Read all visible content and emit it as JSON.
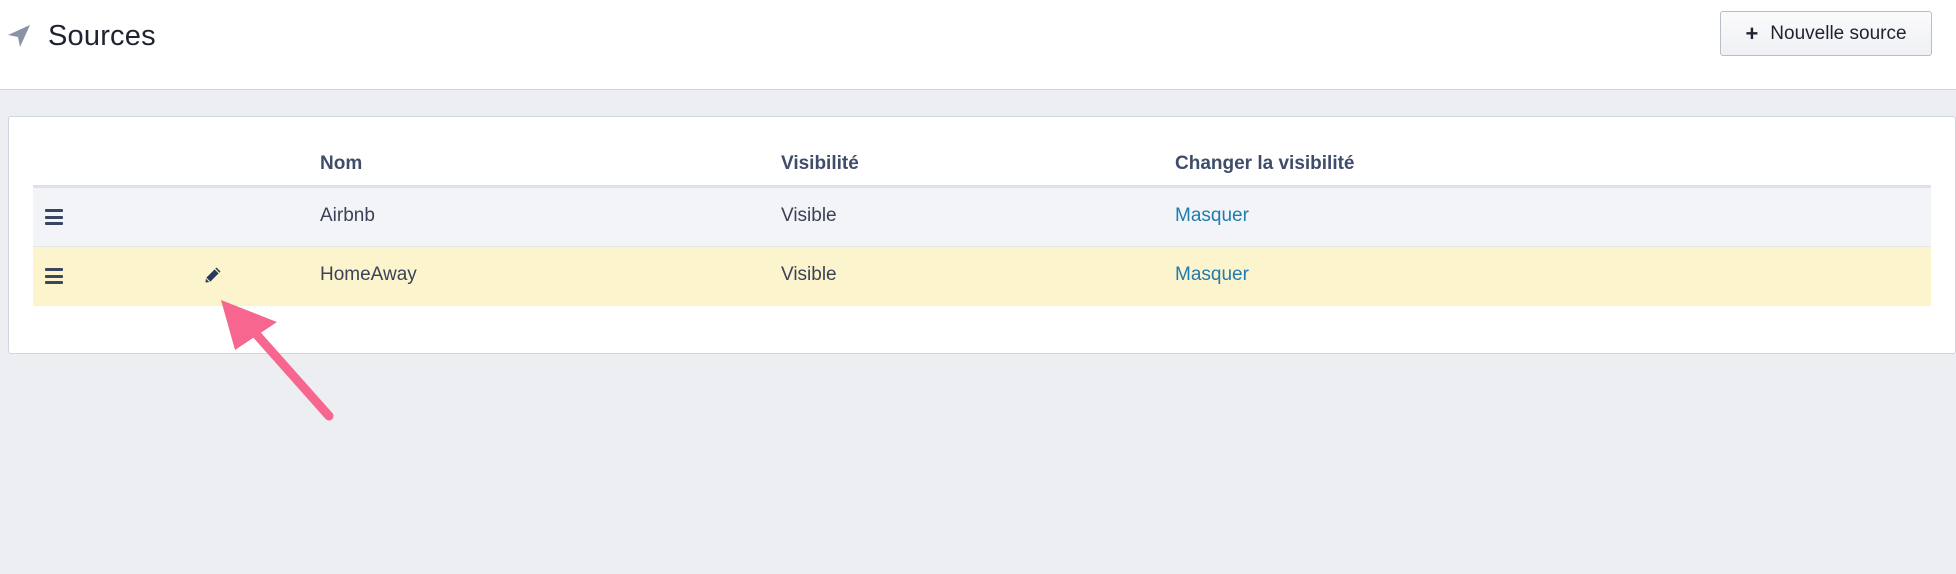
{
  "header": {
    "title": "Sources",
    "icon": "location-arrow-icon",
    "new_source_label": "Nouvelle source"
  },
  "table": {
    "columns": [
      "Nom",
      "Visibilité",
      "Changer la visibilité"
    ],
    "rows": [
      {
        "name": "Airbnb",
        "visibility": "Visible",
        "action": "Masquer"
      },
      {
        "name": "HomeAway",
        "visibility": "Visible",
        "action": "Masquer"
      }
    ]
  },
  "colors": {
    "accent_link": "#1f7bb0",
    "highlight_row": "#fcf4cc",
    "annotation_arrow": "#f7668f"
  }
}
